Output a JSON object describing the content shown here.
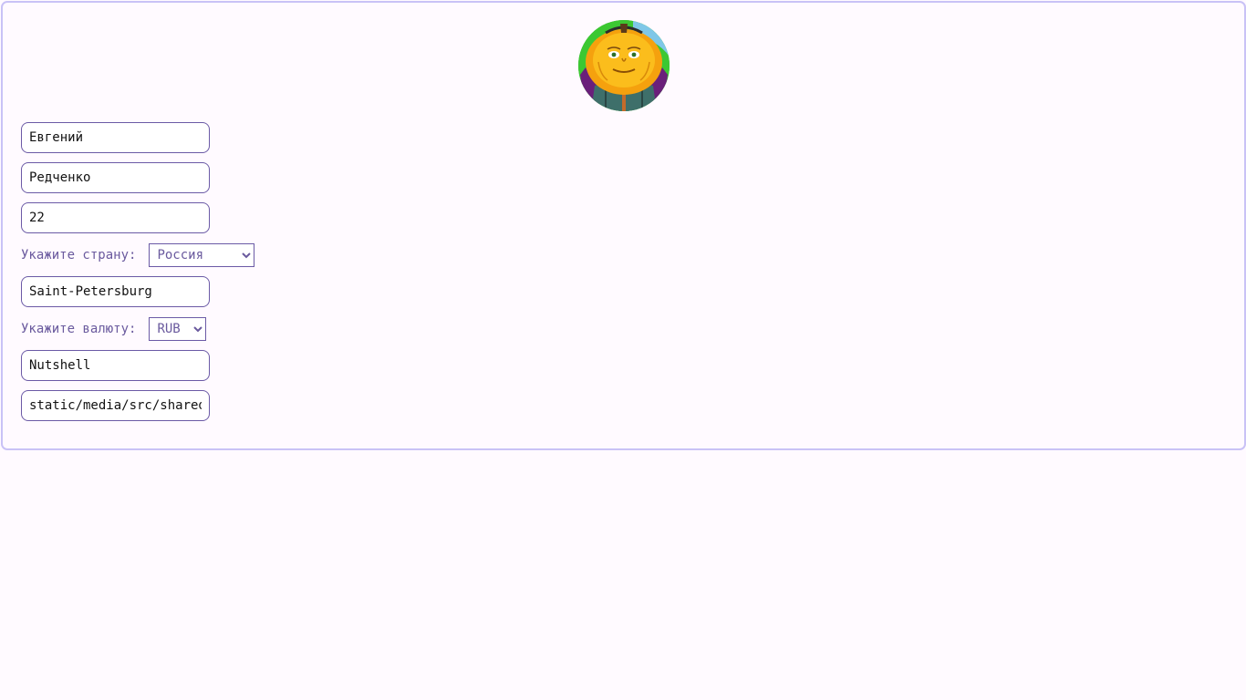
{
  "profile": {
    "first_name": "Евгений",
    "last_name": "Редченко",
    "age": "22",
    "country_label": "Укажите страну:",
    "country_value": "Россия",
    "city": "Saint-Petersburg",
    "currency_label": "Укажите валюту:",
    "currency_value": "RUB",
    "nickname": "Nutshell",
    "avatar_path": "static/media/src/shared"
  },
  "icons": {
    "avatar": "pumpkin-character-avatar"
  },
  "colors": {
    "background": "#fffaff",
    "card_border": "#c9c2f6",
    "input_border": "#6b5aa6",
    "label_text": "#6a5a9e"
  }
}
